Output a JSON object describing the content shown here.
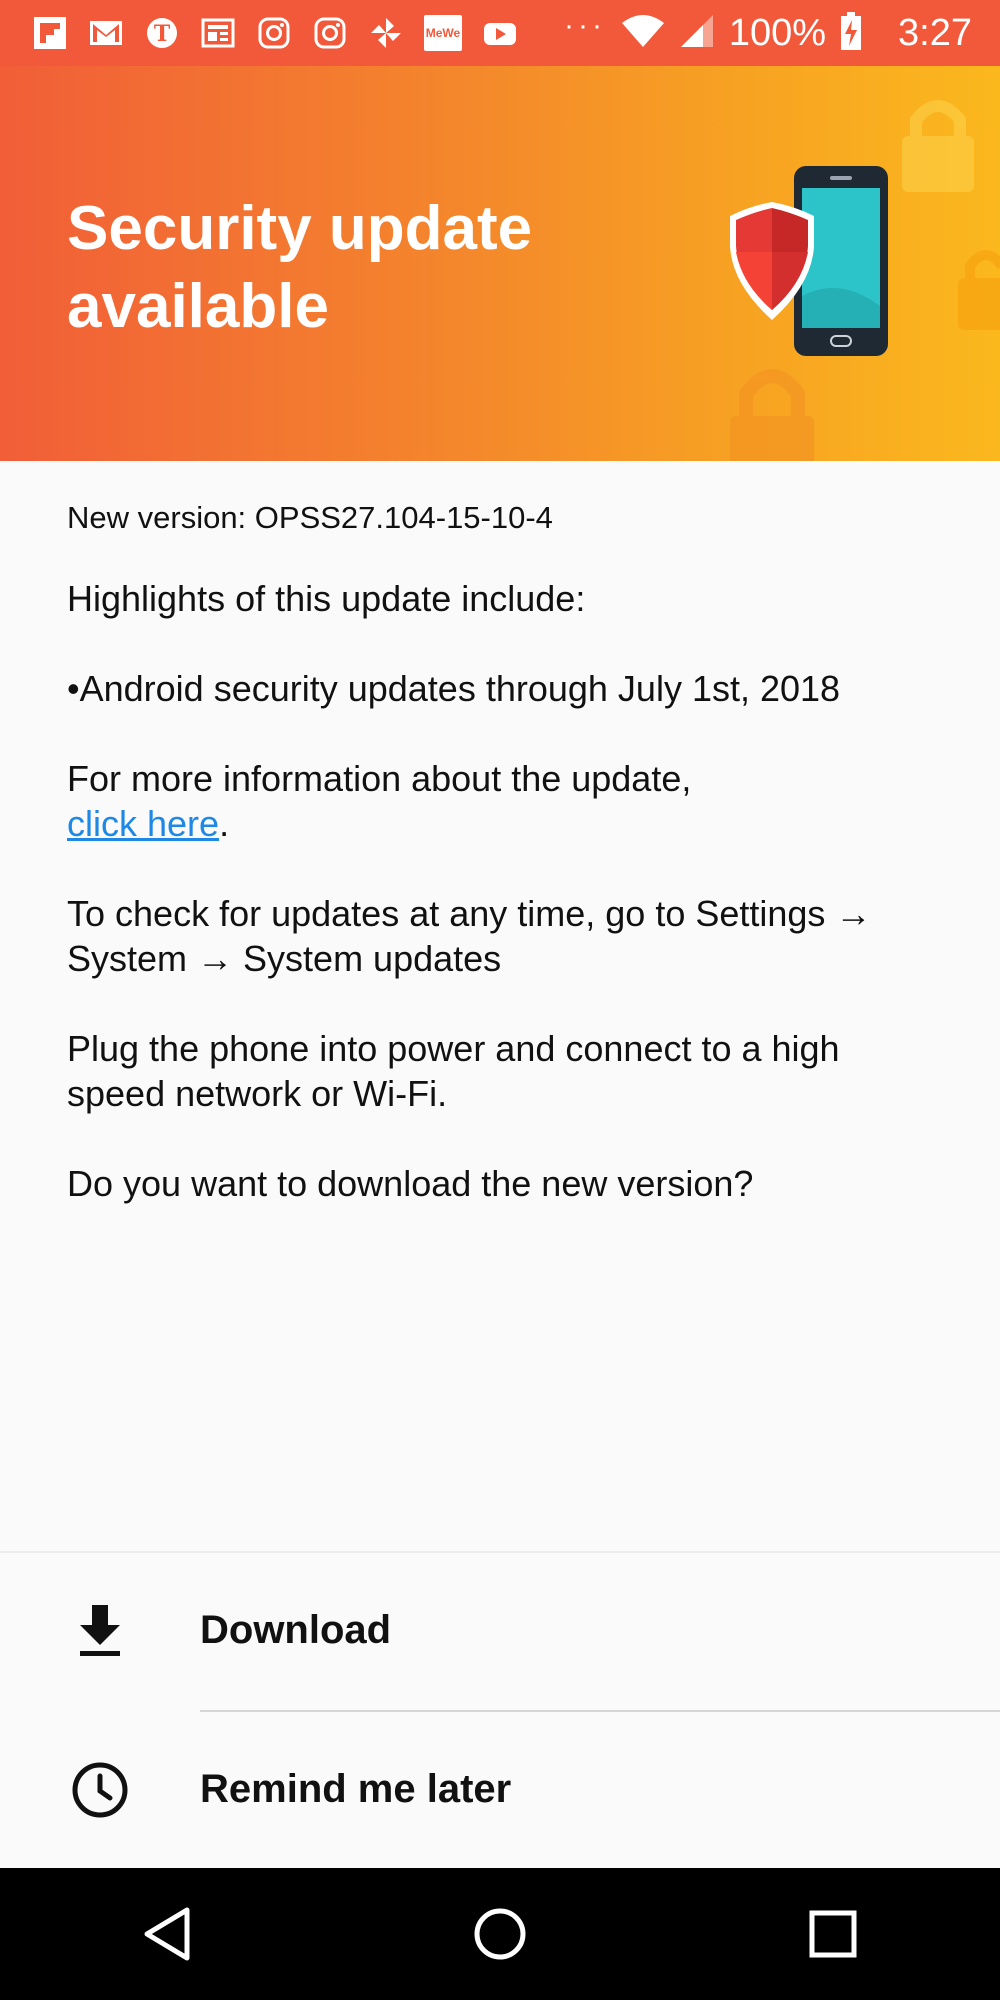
{
  "status_bar": {
    "notification_icons": [
      "flipboard-icon",
      "gmail-icon",
      "nytimes-icon",
      "news-icon",
      "instagram-icon",
      "instagram-icon",
      "pinwheel-icon",
      "mewe-icon",
      "youtube-icon"
    ],
    "mewe_label": "MeWe",
    "more_indicator": "···",
    "battery": "100%",
    "time": "3:27"
  },
  "header": {
    "title": "Security update available",
    "accent_colors": [
      "#f15e38",
      "#fbb81d"
    ]
  },
  "content": {
    "version": "New version: OPSS27.104-15-10-4",
    "highlights_heading": "Highlights of this update include:",
    "bullet": "•Android security updates through July 1st, 2018",
    "more_info_prefix": "For more information about the update,",
    "more_info_link": "click here",
    "more_info_suffix": ".",
    "check_updates": "To check for updates at any time, go to Settings → System → System updates",
    "plug_in": "Plug the phone into power and connect to a high speed network or Wi-Fi.",
    "question": "Do you want to download the new version?"
  },
  "actions": {
    "download_label": "Download",
    "remind_label": "Remind me later"
  },
  "nav_bar": {
    "buttons": [
      "back-icon",
      "home-icon",
      "recents-icon"
    ]
  },
  "colors": {
    "status_bar": "#f1593a",
    "link": "#1e88e5",
    "background": "#fafafa"
  }
}
